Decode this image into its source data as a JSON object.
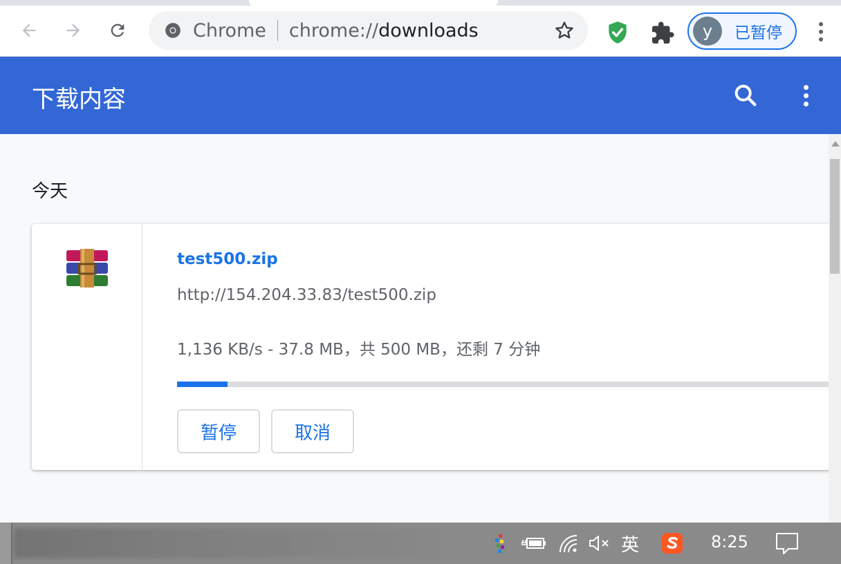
{
  "browser": {
    "omnibox": {
      "chip": "Chrome",
      "url_scheme": "chrome://",
      "url_host": "downloads"
    },
    "profile": {
      "avatar_letter": "y",
      "status": "已暂停"
    }
  },
  "page": {
    "header_title": "下载内容",
    "date_group": "今天",
    "download": {
      "file_name": "test500.zip",
      "url": "http://154.204.33.83/test500.zip",
      "status": "1,136 KB/s - 37.8 MB，共 500 MB，还剩 7 分钟",
      "progress_percent": 7.56,
      "pause_label": "暂停",
      "cancel_label": "取消"
    }
  },
  "taskbar": {
    "ime_label": "英",
    "clock": "8:25"
  },
  "colors": {
    "header_blue": "#3367d6",
    "link_blue": "#1a73e8",
    "shield_green": "#34a853"
  }
}
